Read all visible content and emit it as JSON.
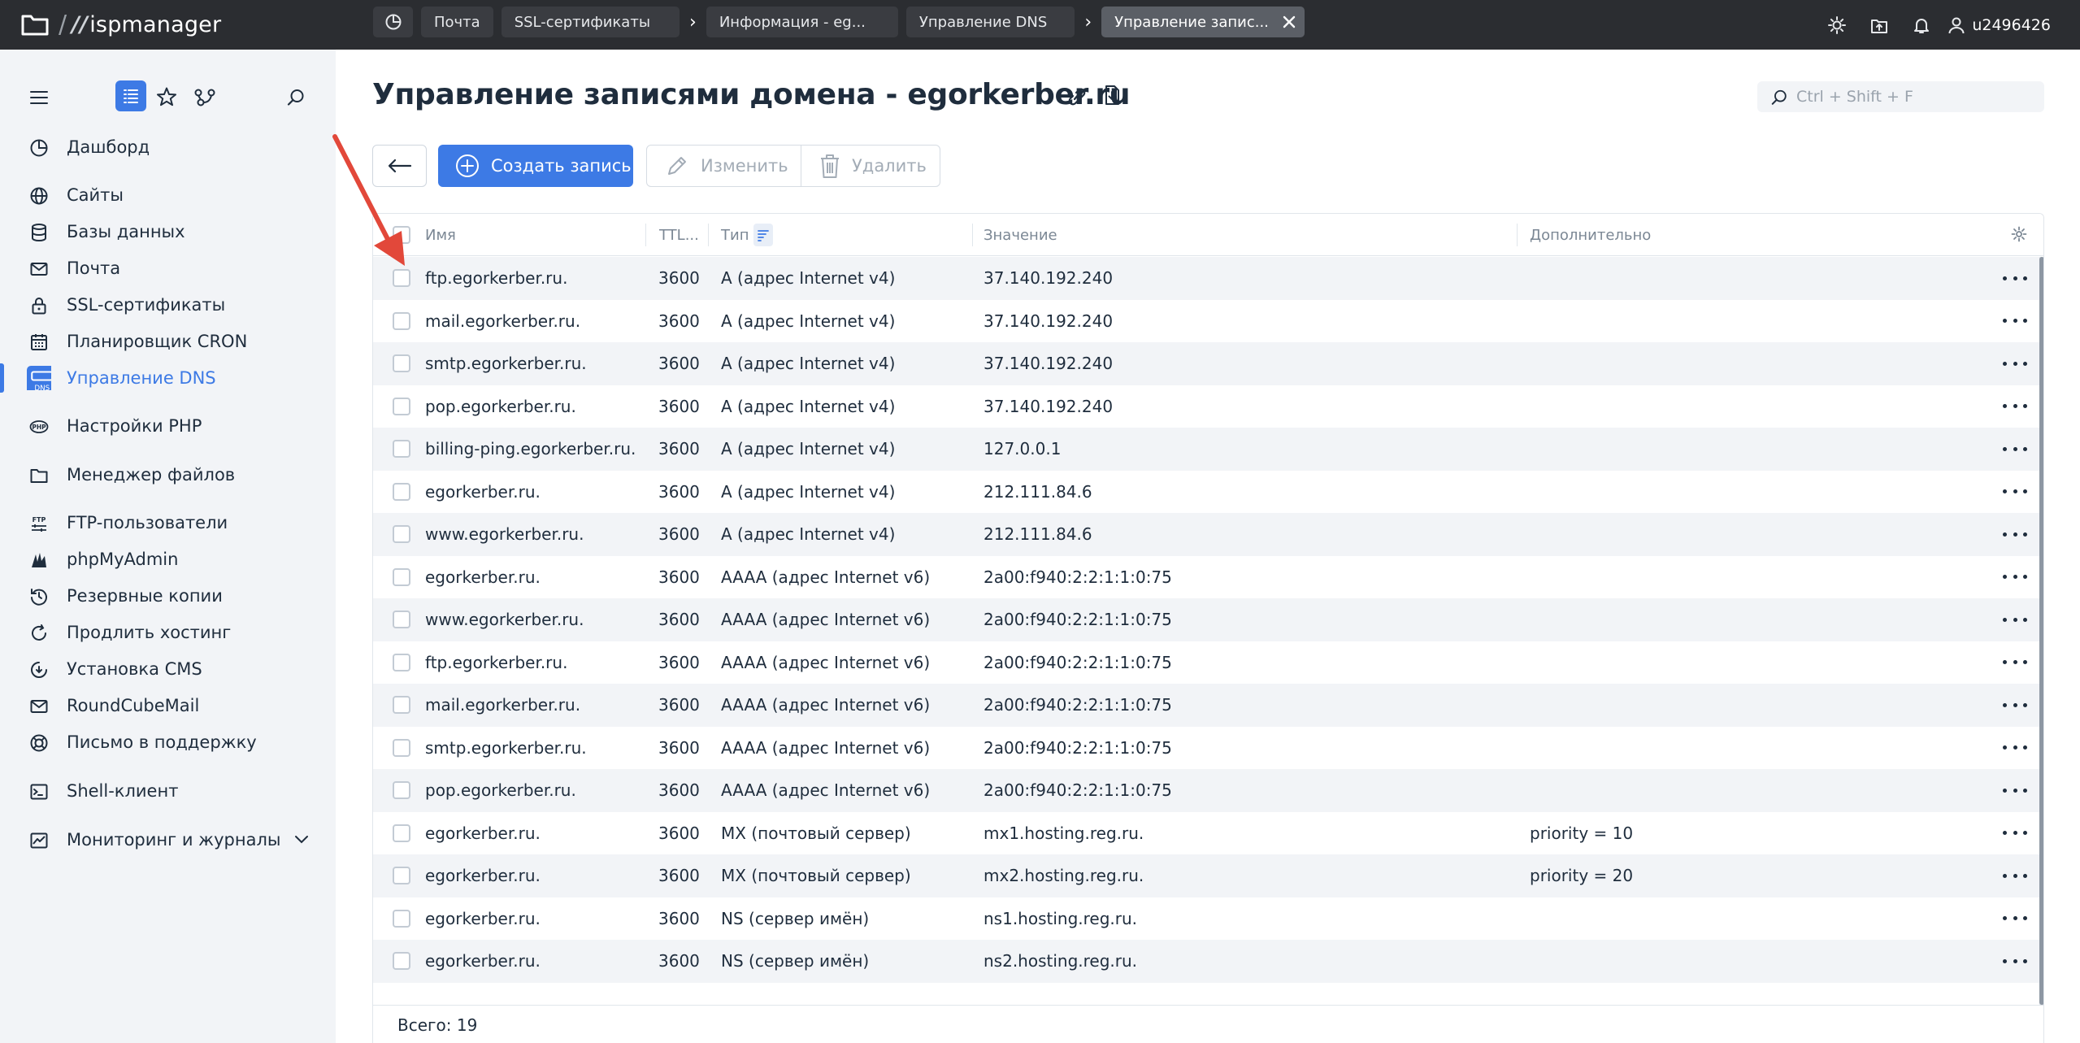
{
  "app": {
    "logo_prefix": "//",
    "logo_text": "ispmanager",
    "user": "u2496426"
  },
  "breadcrumbs": [
    "Почта",
    "SSL-сертификаты",
    "Информация - eg...",
    "Управление DNS",
    "Управление запис..."
  ],
  "sidebar": {
    "items": [
      {
        "label": "Дашборд",
        "icon": "dashboard-icon"
      },
      {
        "label": "Сайты",
        "icon": "globe-icon"
      },
      {
        "label": "Базы данных",
        "icon": "database-icon"
      },
      {
        "label": "Почта",
        "icon": "mail-icon"
      },
      {
        "label": "SSL-сертификаты",
        "icon": "lock-icon"
      },
      {
        "label": "Планировщик CRON",
        "icon": "calendar-icon"
      },
      {
        "label": "Управление DNS",
        "icon": "dns-icon",
        "active": true
      },
      {
        "label": "Настройки PHP",
        "icon": "php-icon"
      },
      {
        "label": "Менеджер файлов",
        "icon": "folder-icon"
      },
      {
        "label": "FTP-пользователи",
        "icon": "ftp-icon"
      },
      {
        "label": "phpMyAdmin",
        "icon": "phpmyadmin-icon"
      },
      {
        "label": "Резервные копии",
        "icon": "backup-icon"
      },
      {
        "label": "Продлить хостинг",
        "icon": "refresh-icon"
      },
      {
        "label": "Установка CMS",
        "icon": "cms-icon"
      },
      {
        "label": "RoundCubeMail",
        "icon": "mail-icon"
      },
      {
        "label": "Письмо в поддержку",
        "icon": "support-icon"
      },
      {
        "label": "Shell-клиент",
        "icon": "terminal-icon"
      },
      {
        "label": "Мониторинг и журналы",
        "icon": "chart-icon"
      }
    ]
  },
  "page": {
    "title": "Управление записями домена - egorkerber.ru",
    "search_placeholder": "Ctrl + Shift + F"
  },
  "toolbar": {
    "create_label": "Создать запись",
    "edit_label": "Изменить",
    "delete_label": "Удалить"
  },
  "table": {
    "columns": [
      "Имя",
      "TTL...",
      "Тип",
      "Значение",
      "Дополнительно"
    ],
    "rows": [
      {
        "name": "ftp.egorkerber.ru.",
        "ttl": "3600",
        "type": "A (адрес Internet v4)",
        "value": "37.140.192.240",
        "extra": ""
      },
      {
        "name": "mail.egorkerber.ru.",
        "ttl": "3600",
        "type": "A (адрес Internet v4)",
        "value": "37.140.192.240",
        "extra": ""
      },
      {
        "name": "smtp.egorkerber.ru.",
        "ttl": "3600",
        "type": "A (адрес Internet v4)",
        "value": "37.140.192.240",
        "extra": ""
      },
      {
        "name": "pop.egorkerber.ru.",
        "ttl": "3600",
        "type": "A (адрес Internet v4)",
        "value": "37.140.192.240",
        "extra": ""
      },
      {
        "name": "billing-ping.egorkerber.ru.",
        "ttl": "3600",
        "type": "A (адрес Internet v4)",
        "value": "127.0.0.1",
        "extra": ""
      },
      {
        "name": "egorkerber.ru.",
        "ttl": "3600",
        "type": "A (адрес Internet v4)",
        "value": "212.111.84.6",
        "extra": ""
      },
      {
        "name": "www.egorkerber.ru.",
        "ttl": "3600",
        "type": "A (адрес Internet v4)",
        "value": "212.111.84.6",
        "extra": ""
      },
      {
        "name": "egorkerber.ru.",
        "ttl": "3600",
        "type": "AAAA (адрес Internet v6)",
        "value": "2a00:f940:2:2:1:1:0:75",
        "extra": ""
      },
      {
        "name": "www.egorkerber.ru.",
        "ttl": "3600",
        "type": "AAAA (адрес Internet v6)",
        "value": "2a00:f940:2:2:1:1:0:75",
        "extra": ""
      },
      {
        "name": "ftp.egorkerber.ru.",
        "ttl": "3600",
        "type": "AAAA (адрес Internet v6)",
        "value": "2a00:f940:2:2:1:1:0:75",
        "extra": ""
      },
      {
        "name": "mail.egorkerber.ru.",
        "ttl": "3600",
        "type": "AAAA (адрес Internet v6)",
        "value": "2a00:f940:2:2:1:1:0:75",
        "extra": ""
      },
      {
        "name": "smtp.egorkerber.ru.",
        "ttl": "3600",
        "type": "AAAA (адрес Internet v6)",
        "value": "2a00:f940:2:2:1:1:0:75",
        "extra": ""
      },
      {
        "name": "pop.egorkerber.ru.",
        "ttl": "3600",
        "type": "AAAA (адрес Internet v6)",
        "value": "2a00:f940:2:2:1:1:0:75",
        "extra": ""
      },
      {
        "name": "egorkerber.ru.",
        "ttl": "3600",
        "type": "MX (почтовый сервер)",
        "value": "mx1.hosting.reg.ru.",
        "extra": "priority = 10"
      },
      {
        "name": "egorkerber.ru.",
        "ttl": "3600",
        "type": "MX (почтовый сервер)",
        "value": "mx2.hosting.reg.ru.",
        "extra": "priority = 20"
      },
      {
        "name": "egorkerber.ru.",
        "ttl": "3600",
        "type": "NS (сервер имён)",
        "value": "ns1.hosting.reg.ru.",
        "extra": ""
      },
      {
        "name": "egorkerber.ru.",
        "ttl": "3600",
        "type": "NS (сервер имён)",
        "value": "ns2.hosting.reg.ru.",
        "extra": ""
      }
    ],
    "total_label": "Всего: 19"
  },
  "colors": {
    "accent": "#3d7ae5",
    "topbar": "#2b2d31",
    "sidebar": "#f2f4f7",
    "annotation": "#e2483a"
  }
}
